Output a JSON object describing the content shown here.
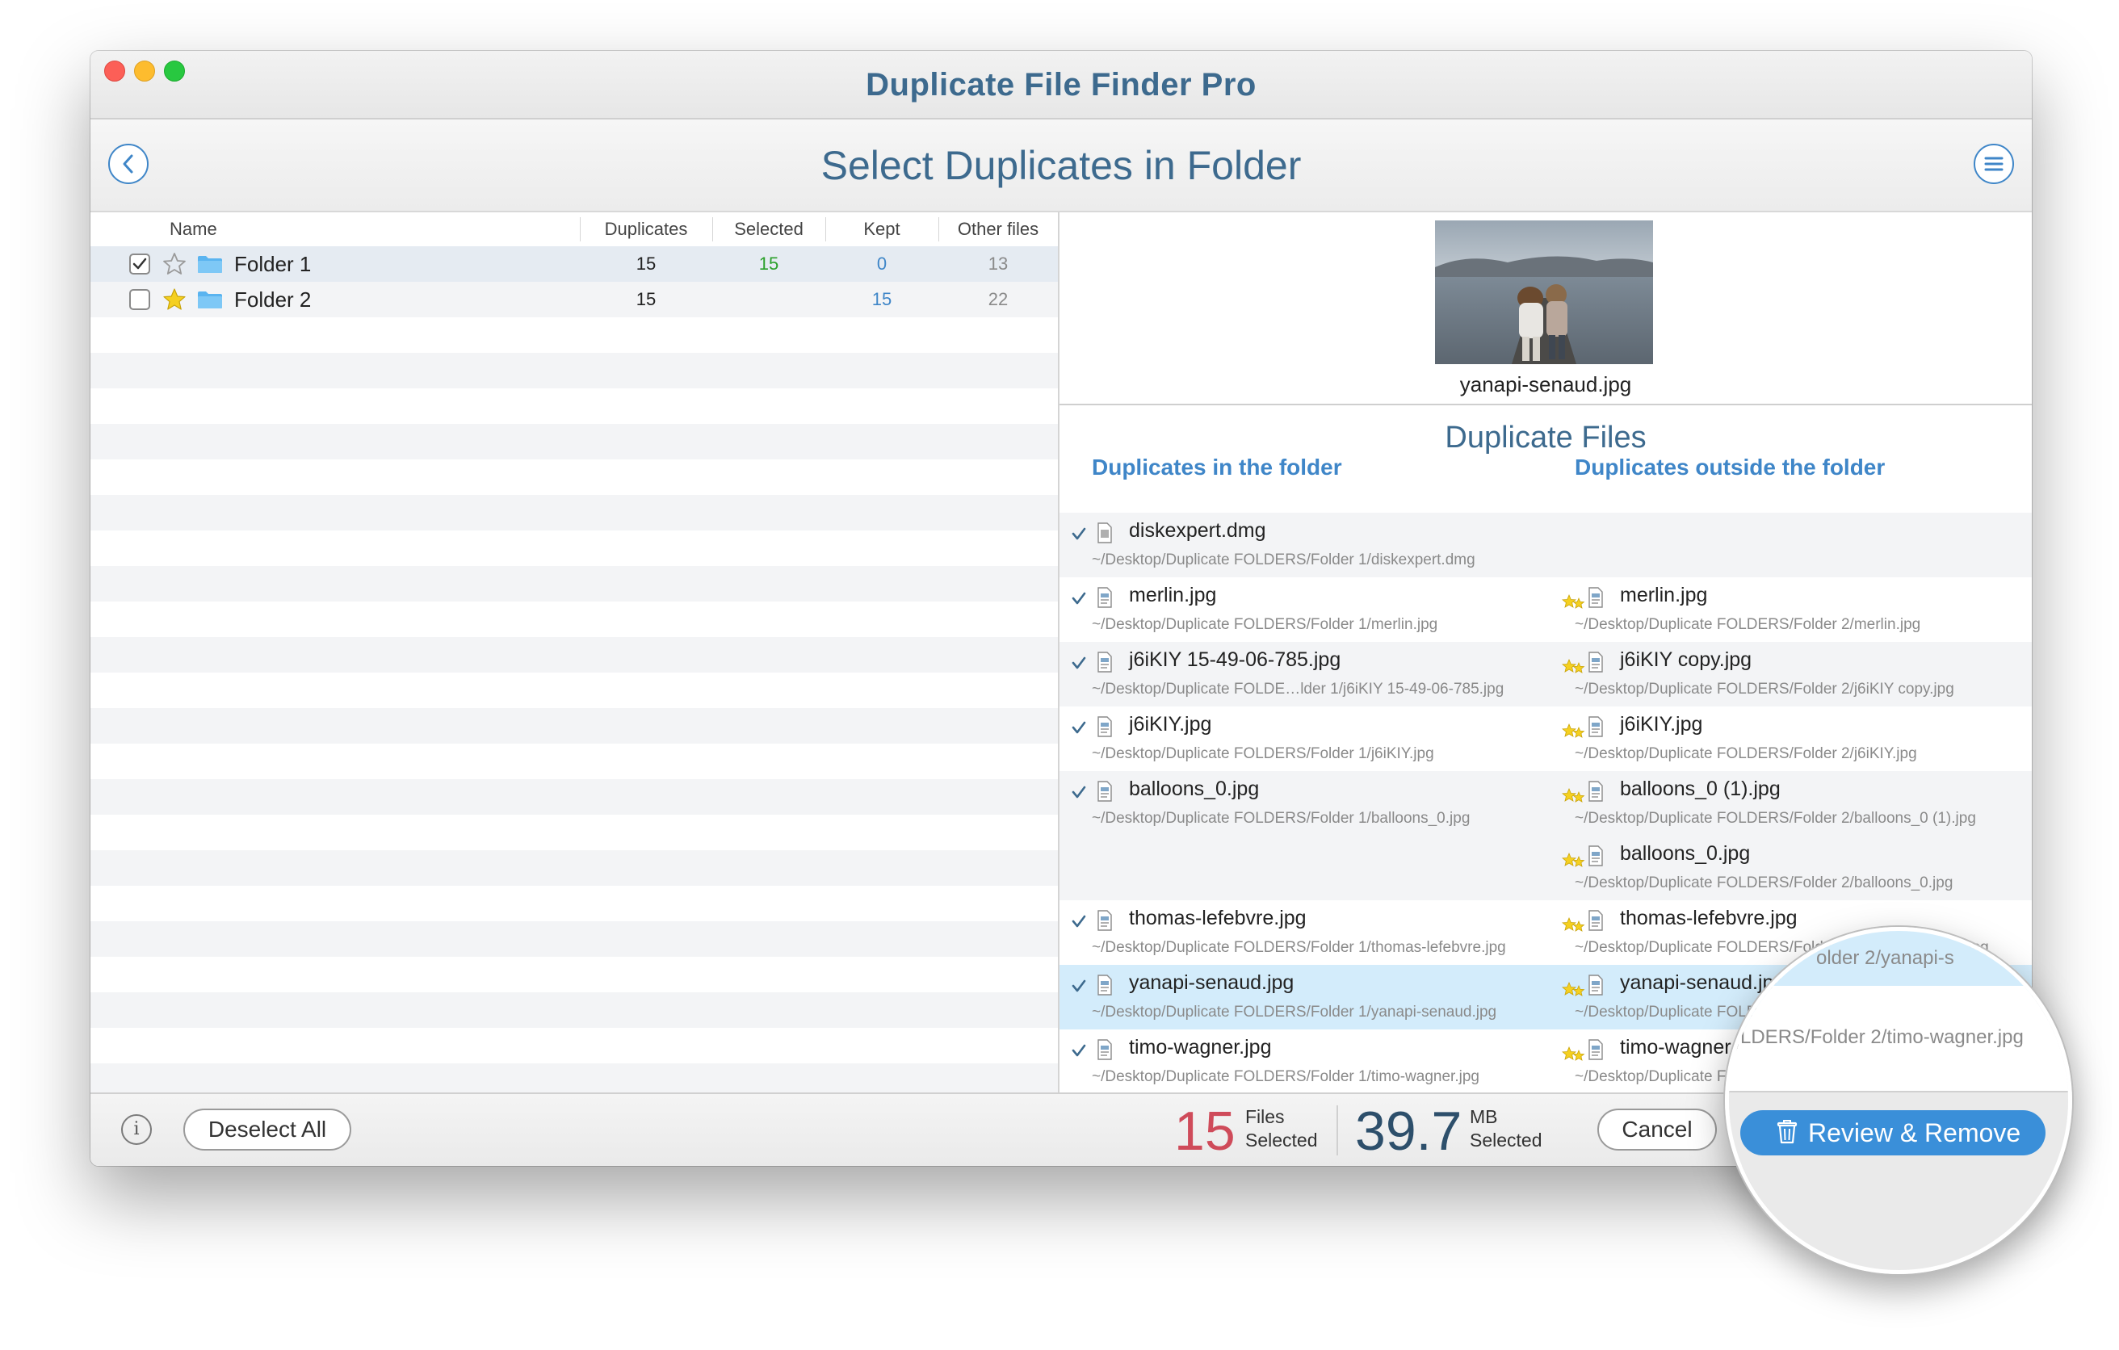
{
  "window": {
    "app_title": "Duplicate File Finder Pro",
    "page_title": "Select Duplicates in Folder"
  },
  "folders_table": {
    "columns": {
      "name": "Name",
      "duplicates": "Duplicates",
      "selected": "Selected",
      "kept": "Kept",
      "other": "Other files"
    },
    "rows": [
      {
        "name": "Folder 1",
        "checked": true,
        "starred": false,
        "duplicates": "15",
        "selected": "15",
        "kept": "0",
        "other": "13"
      },
      {
        "name": "Folder 2",
        "checked": false,
        "starred": true,
        "duplicates": "15",
        "selected": "",
        "kept": "15",
        "other": "22"
      }
    ]
  },
  "preview": {
    "file_name": "yanapi-senaud.jpg"
  },
  "duplicates": {
    "title": "Duplicate Files",
    "in_folder_label": "Duplicates in the folder",
    "outside_folder_label": "Duplicates outside the folder",
    "rows": [
      {
        "left": {
          "name": "diskexpert.dmg",
          "path": "~/Desktop/Duplicate FOLDERS/Folder 1/diskexpert.dmg"
        },
        "right": []
      },
      {
        "left": {
          "name": "merlin.jpg",
          "path": "~/Desktop/Duplicate FOLDERS/Folder 1/merlin.jpg"
        },
        "right": [
          {
            "name": "merlin.jpg",
            "path": "~/Desktop/Duplicate FOLDERS/Folder 2/merlin.jpg"
          }
        ]
      },
      {
        "left": {
          "name": "j6iKIY 15-49-06-785.jpg",
          "path": "~/Desktop/Duplicate FOLDE…lder 1/j6iKIY 15-49-06-785.jpg"
        },
        "right": [
          {
            "name": "j6iKIY copy.jpg",
            "path": "~/Desktop/Duplicate FOLDERS/Folder 2/j6iKIY copy.jpg"
          }
        ]
      },
      {
        "left": {
          "name": "j6iKIY.jpg",
          "path": "~/Desktop/Duplicate FOLDERS/Folder 1/j6iKIY.jpg"
        },
        "right": [
          {
            "name": "j6iKIY.jpg",
            "path": "~/Desktop/Duplicate FOLDERS/Folder 2/j6iKIY.jpg"
          }
        ]
      },
      {
        "left": {
          "name": "balloons_0.jpg",
          "path": "~/Desktop/Duplicate FOLDERS/Folder 1/balloons_0.jpg"
        },
        "right": [
          {
            "name": "balloons_0 (1).jpg",
            "path": "~/Desktop/Duplicate FOLDERS/Folder 2/balloons_0 (1).jpg"
          },
          {
            "name": "balloons_0.jpg",
            "path": "~/Desktop/Duplicate FOLDERS/Folder 2/balloons_0.jpg"
          }
        ]
      },
      {
        "left": {
          "name": "thomas-lefebvre.jpg",
          "path": "~/Desktop/Duplicate FOLDERS/Folder 1/thomas-lefebvre.jpg"
        },
        "right": [
          {
            "name": "thomas-lefebvre.jpg",
            "path": "~/Desktop/Duplicate FOLDERS/Folder 2/thomas-lefebvre.jpg"
          }
        ]
      },
      {
        "left": {
          "name": "yanapi-senaud.jpg",
          "path": "~/Desktop/Duplicate FOLDERS/Folder 1/yanapi-senaud.jpg"
        },
        "right": [
          {
            "name": "yanapi-senaud.jpg",
            "path": "~/Desktop/Duplicate FOLDER"
          }
        ]
      },
      {
        "left": {
          "name": "timo-wagner.jpg",
          "path": "~/Desktop/Duplicate FOLDERS/Folder 1/timo-wagner.jpg"
        },
        "right": [
          {
            "name": "timo-wagner.jpg",
            "path": "~/Desktop/Duplicate F"
          }
        ]
      }
    ]
  },
  "footer": {
    "info_label": "i",
    "deselect_label": "Deselect All",
    "files_count": "15",
    "files_label_1": "Files",
    "files_label_2": "Selected",
    "size_value": "39.7",
    "size_unit": "MB",
    "size_label": "Selected",
    "cancel_label": "Cancel",
    "review_label": "Review & Remove"
  },
  "magnifier": {
    "path_top": "older 2/yanapi-s",
    "path_bottom": "LDERS/Folder 2/timo-wagner.jpg",
    "button_label": "Review & Remove"
  },
  "colors": {
    "title": "#3d6a8e",
    "accent": "#3f86c8",
    "files_count": "#cf4b5a",
    "size_value": "#2d4f6b",
    "selected_green": "#2aa02a",
    "kept_blue": "#3f86c8",
    "highlight_row": "#d3ecfb"
  },
  "icons": [
    "back-chevron-icon",
    "menu-list-icon",
    "checkbox-icon",
    "star-icon",
    "folder-icon",
    "checkmark-icon",
    "file-icon",
    "double-star-icon",
    "info-icon",
    "trash-icon"
  ]
}
